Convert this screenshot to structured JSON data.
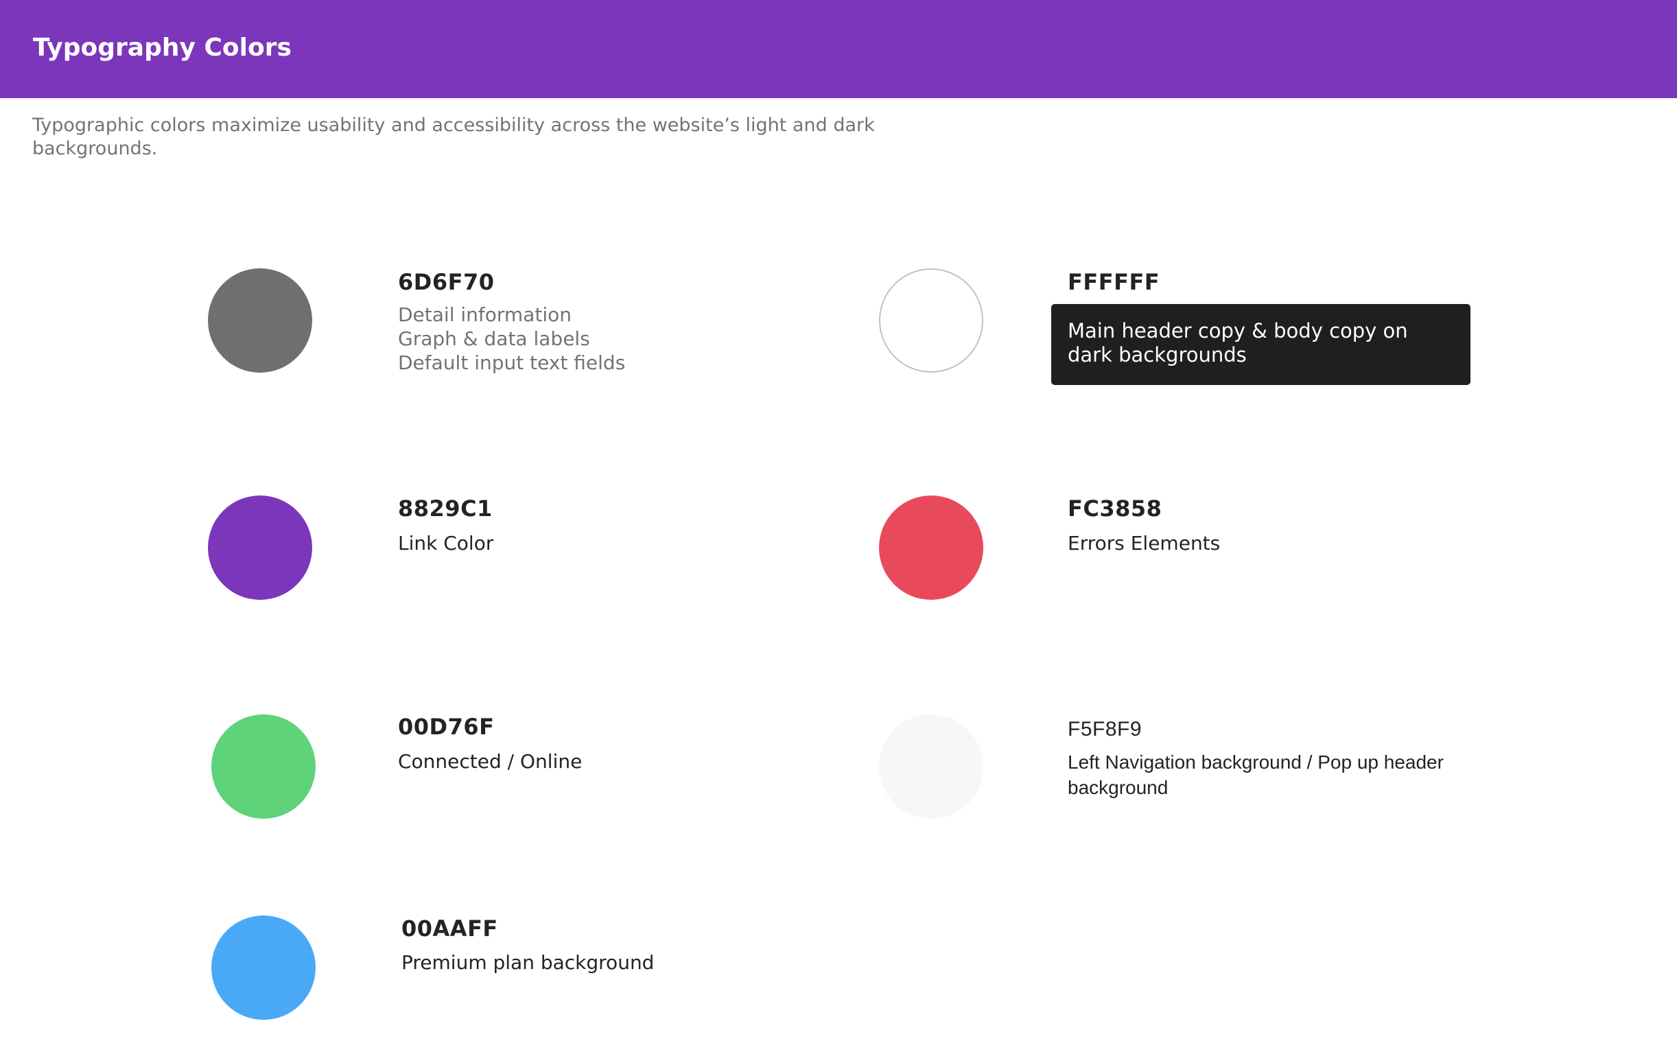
{
  "header": {
    "title": "Typography Colors",
    "bg_color": "#7B36BB"
  },
  "intro": "Typographic colors maximize usability and accessibility across the website’s light and dark backgrounds.",
  "swatches": [
    {
      "hex": "6D6F70",
      "color": "#6D6F70",
      "lines": [
        "Detail information",
        "Graph & data labels",
        "Default input text fields"
      ]
    },
    {
      "hex": "FFFFFF",
      "color": "#FFFFFF",
      "border_color": "#B9C3CC",
      "lines": [
        "Main header copy & body copy on dark backgrounds"
      ],
      "label_bg": "#1E1F21"
    },
    {
      "hex": "8829C1",
      "color": "#7B36BB",
      "lines": [
        "Link Color"
      ]
    },
    {
      "hex": "FC3858",
      "color": "#E94A5B",
      "lines": [
        "Errors Elements"
      ]
    },
    {
      "hex": "00D76F",
      "color": "#5FD379",
      "lines": [
        "Connected / Online"
      ]
    },
    {
      "hex": "F5F8F9",
      "color": "#F5F7F8",
      "lines": [
        "Left Navigation background / Pop up header background"
      ]
    },
    {
      "hex": "00AAFF",
      "color": "#4AA9F7",
      "lines": [
        "Premium plan background"
      ]
    }
  ]
}
